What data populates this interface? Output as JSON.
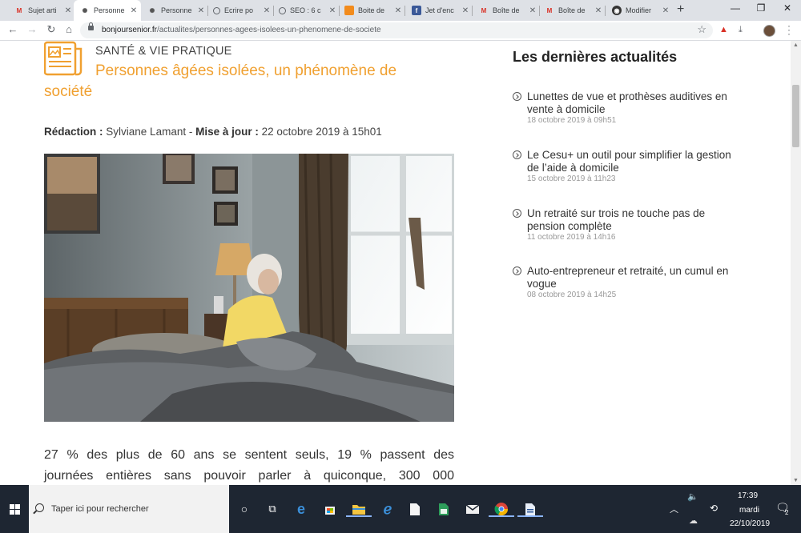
{
  "browser": {
    "tabs": [
      {
        "title": "Sujet arti",
        "icon": "gmail-icon",
        "active": false
      },
      {
        "title": "Personne",
        "icon": "site-icon",
        "active": true
      },
      {
        "title": "Personne",
        "icon": "site-icon",
        "active": false
      },
      {
        "title": "Ecrire po",
        "icon": "globe-icon",
        "active": false
      },
      {
        "title": "SEO : 6 c",
        "icon": "globe-icon",
        "active": false
      },
      {
        "title": "Boite de",
        "icon": "orange-icon",
        "active": false
      },
      {
        "title": "Jet d'enc",
        "icon": "facebook-icon",
        "active": false
      },
      {
        "title": "Boîte de",
        "icon": "gmail-icon",
        "active": false
      },
      {
        "title": "Boîte de",
        "icon": "gmail-icon",
        "active": false
      },
      {
        "title": "Modifier",
        "icon": "dark-icon",
        "active": false
      }
    ],
    "url_domain": "bonjoursenior.fr",
    "url_path": "/actualites/personnes-agees-isolees-un-phenomene-de-societe"
  },
  "article": {
    "category": "SANTÉ & VIE PRATIQUE",
    "title": "Personnes âgées isolées, un phénomène de société",
    "byline_label_author": "Rédaction :",
    "author": "Sylviane Lamant",
    "byline_sep": "-",
    "byline_label_date": "Mise à jour :",
    "date": "22 octobre 2019 à 15h01",
    "body_lines": [
      "27 % des plus de 60 ans se sentent seuls, 19 % passent des",
      "journées entières sans pouvoir parler à quiconque, 300 000"
    ]
  },
  "sidebar": {
    "title": "Les dernières actualités",
    "items": [
      {
        "title": "Lunettes de vue et prothèses auditives en vente à domicile",
        "date": "18 octobre 2019 à 09h51"
      },
      {
        "title": "Le Cesu+ un outil pour simplifier la gestion de l’aide à domicile",
        "date": "15 octobre 2019 à 11h23"
      },
      {
        "title": "Un retraité sur trois ne touche pas de pension complète",
        "date": "11 octobre 2019 à 14h16"
      },
      {
        "title": "Auto-entrepreneur et retraité, un cumul en vogue",
        "date": "08 octobre 2019 à 14h25"
      }
    ]
  },
  "taskbar": {
    "search_placeholder": "Taper ici pour rechercher",
    "time": "17:39",
    "day": "mardi",
    "date": "22/10/2019",
    "notification_count": "2"
  },
  "colors": {
    "accent": "#f0a030",
    "taskbar": "#1e2632"
  }
}
